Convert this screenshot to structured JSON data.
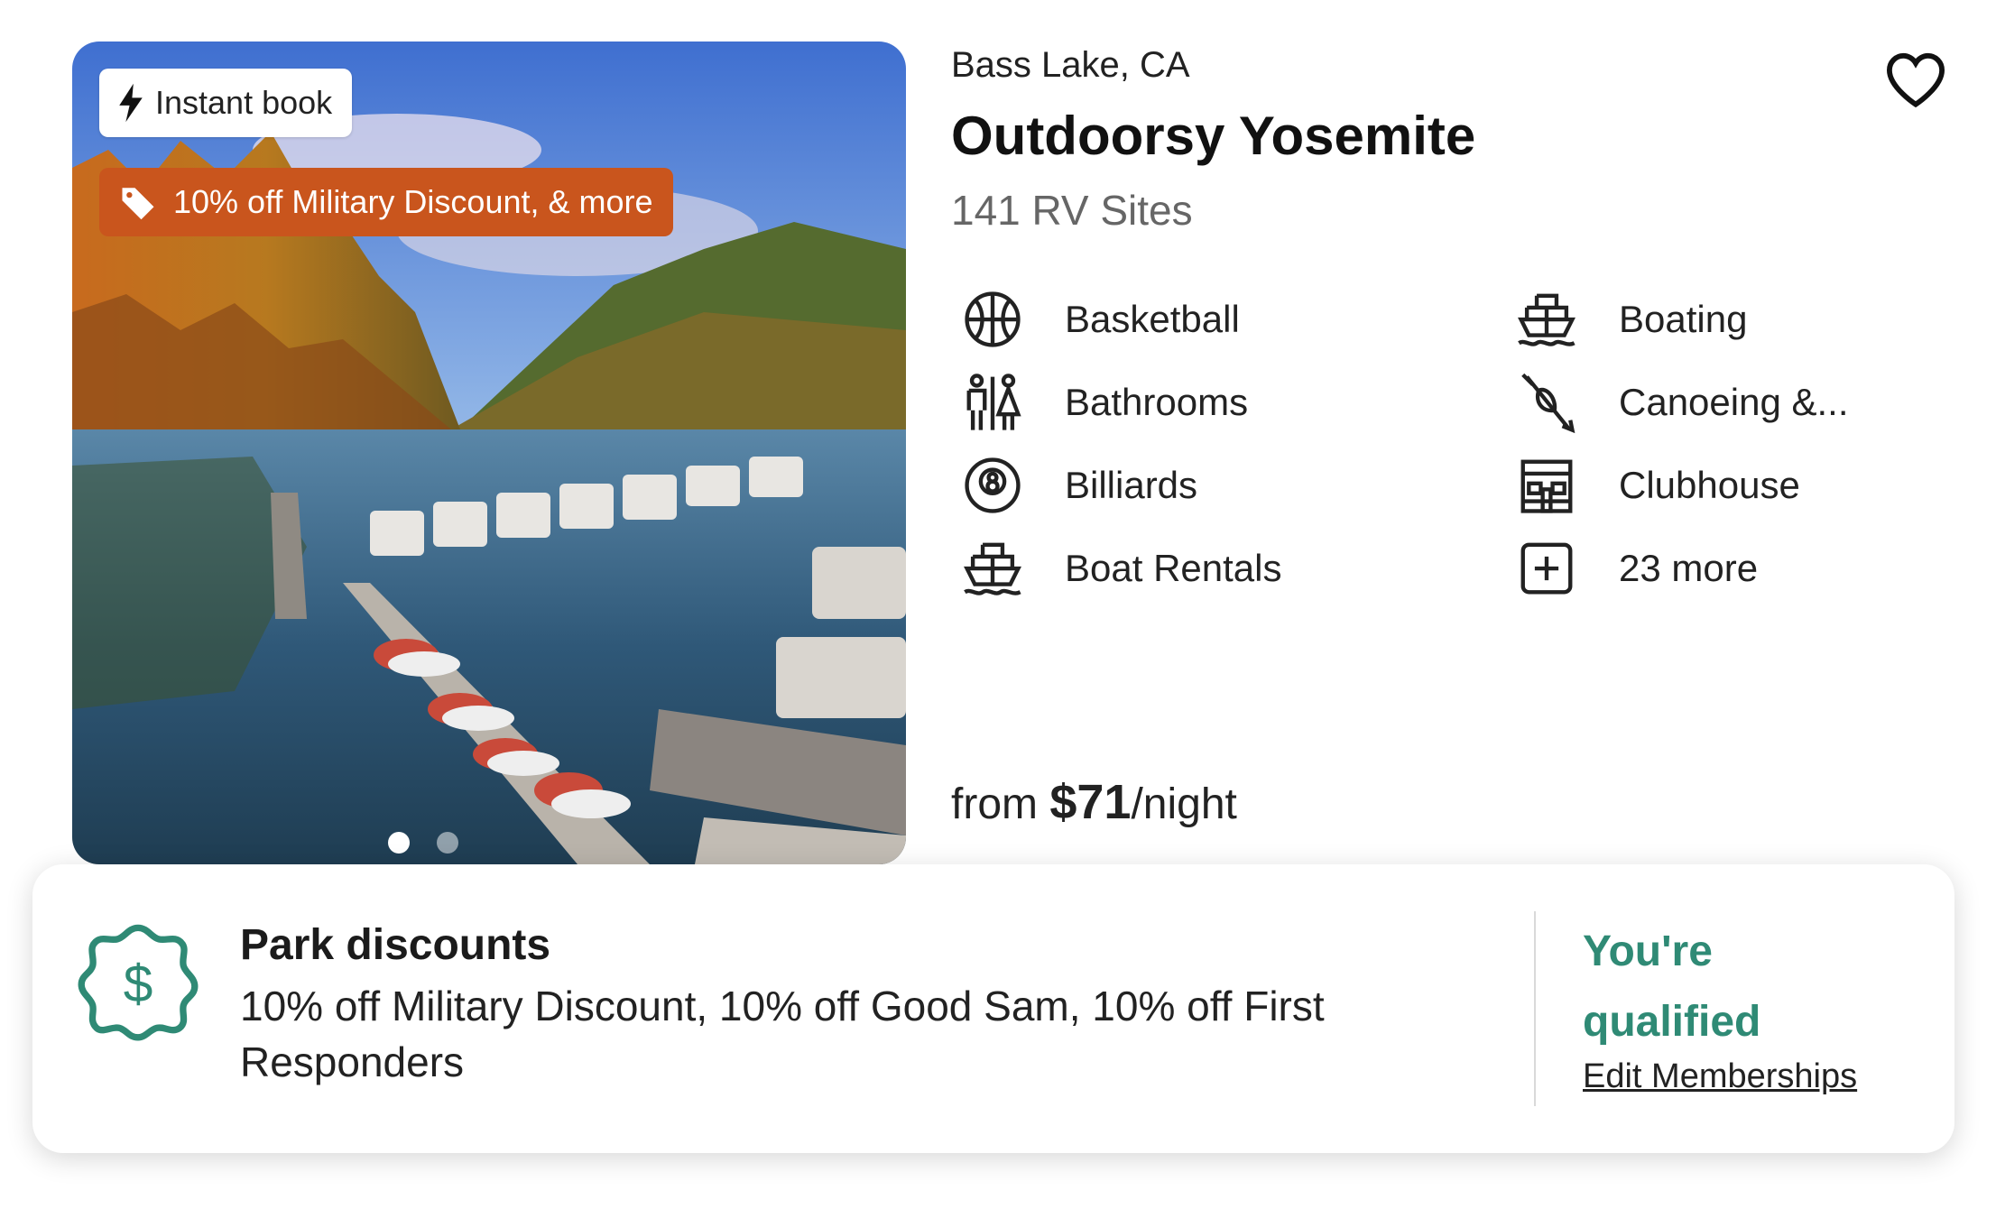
{
  "badges": {
    "instant_book": "Instant book",
    "discount": "10% off Military Discount, & more"
  },
  "carousel": {
    "total_slides": 2,
    "active_slide": 1
  },
  "listing": {
    "location": "Bass Lake, CA",
    "title": "Outdoorsy Yosemite",
    "sites": "141 RV Sites"
  },
  "amenities": [
    {
      "label": "Basketball",
      "icon": "basketball-icon"
    },
    {
      "label": "Bathrooms",
      "icon": "bathrooms-icon"
    },
    {
      "label": "Billiards",
      "icon": "billiards-icon"
    },
    {
      "label": "Boat Rentals",
      "icon": "boat-icon"
    },
    {
      "label": "Boating",
      "icon": "boat-icon"
    },
    {
      "label": "Canoeing &...",
      "icon": "canoe-icon"
    },
    {
      "label": "Clubhouse",
      "icon": "clubhouse-icon"
    },
    {
      "label": "23 more",
      "icon": "plus-box-icon"
    }
  ],
  "price": {
    "prefix": "from ",
    "amount": "$71",
    "suffix": "/night"
  },
  "discounts": {
    "title": "Park discounts",
    "description": "10% off Military Discount, 10% off Good Sam, 10% off First Responders",
    "status": "You're qualified",
    "edit_link": "Edit Memberships"
  },
  "colors": {
    "discount_badge": "#c9551d",
    "qualified_green": "#2f8a75"
  }
}
